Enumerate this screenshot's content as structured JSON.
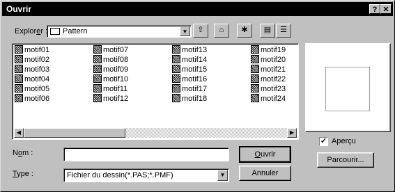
{
  "window": {
    "title": "Ouvrir",
    "help_btn": "?",
    "close_btn": "✕"
  },
  "lookin": {
    "label_pre": "Explor",
    "label_accel": "e",
    "label_post": "r :",
    "value": "Pattern"
  },
  "toolbar": {
    "up": "⇧",
    "new_folder": "✱",
    "list_view": "▤",
    "details_view": "☰",
    "desktop": "⌂"
  },
  "files": {
    "columns": [
      [
        "motif01",
        "motif02",
        "motif03",
        "motif04",
        "motif05",
        "motif06"
      ],
      [
        "motif07",
        "motif08",
        "motif09",
        "motif10",
        "motif11",
        "motif12"
      ],
      [
        "motif13",
        "motif14",
        "motif15",
        "motif16",
        "motif17",
        "motif18"
      ],
      [
        "motif19",
        "motif20",
        "motif21",
        "motif22",
        "motif23",
        "motif24"
      ]
    ]
  },
  "filename": {
    "label_pre": "N",
    "label_accel": "o",
    "label_post": "m :",
    "value": ""
  },
  "filetype": {
    "label_accel": "T",
    "label_post": "ype :",
    "value": "Fichier du dessin(*.PAS;*.PMF)"
  },
  "buttons": {
    "open_accel": "O",
    "open_post": "uvrir",
    "cancel": "Annuler",
    "browse": "Parcourir..."
  },
  "preview": {
    "checkbox_label": "Aperçu",
    "checked": true
  }
}
